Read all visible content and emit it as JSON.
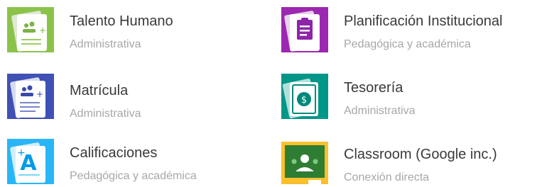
{
  "apps": [
    {
      "title": "Talento Humano",
      "subtitle": "Administrativa",
      "icon": "people-add-icon",
      "color": "#7cb342"
    },
    {
      "title": "Planificación Institucional",
      "subtitle": "Pedagógica y académica",
      "icon": "clipboard-icon",
      "color": "#8e24aa"
    },
    {
      "title": "Matrícula",
      "subtitle": "Administrativa",
      "icon": "people-add-icon",
      "color": "#3949ab"
    },
    {
      "title": "Tesorería",
      "subtitle": "Administrativa",
      "icon": "banknote-icon",
      "color": "#00897b"
    },
    {
      "title": "Calificaciones",
      "subtitle": "Pedagógica y académica",
      "icon": "grade-a-plus-icon",
      "color": "#29b6f6"
    },
    {
      "title": "Classroom (Google inc.)",
      "subtitle": "Conexión directa",
      "icon": "classroom-icon",
      "color": "#fbc02d"
    }
  ]
}
